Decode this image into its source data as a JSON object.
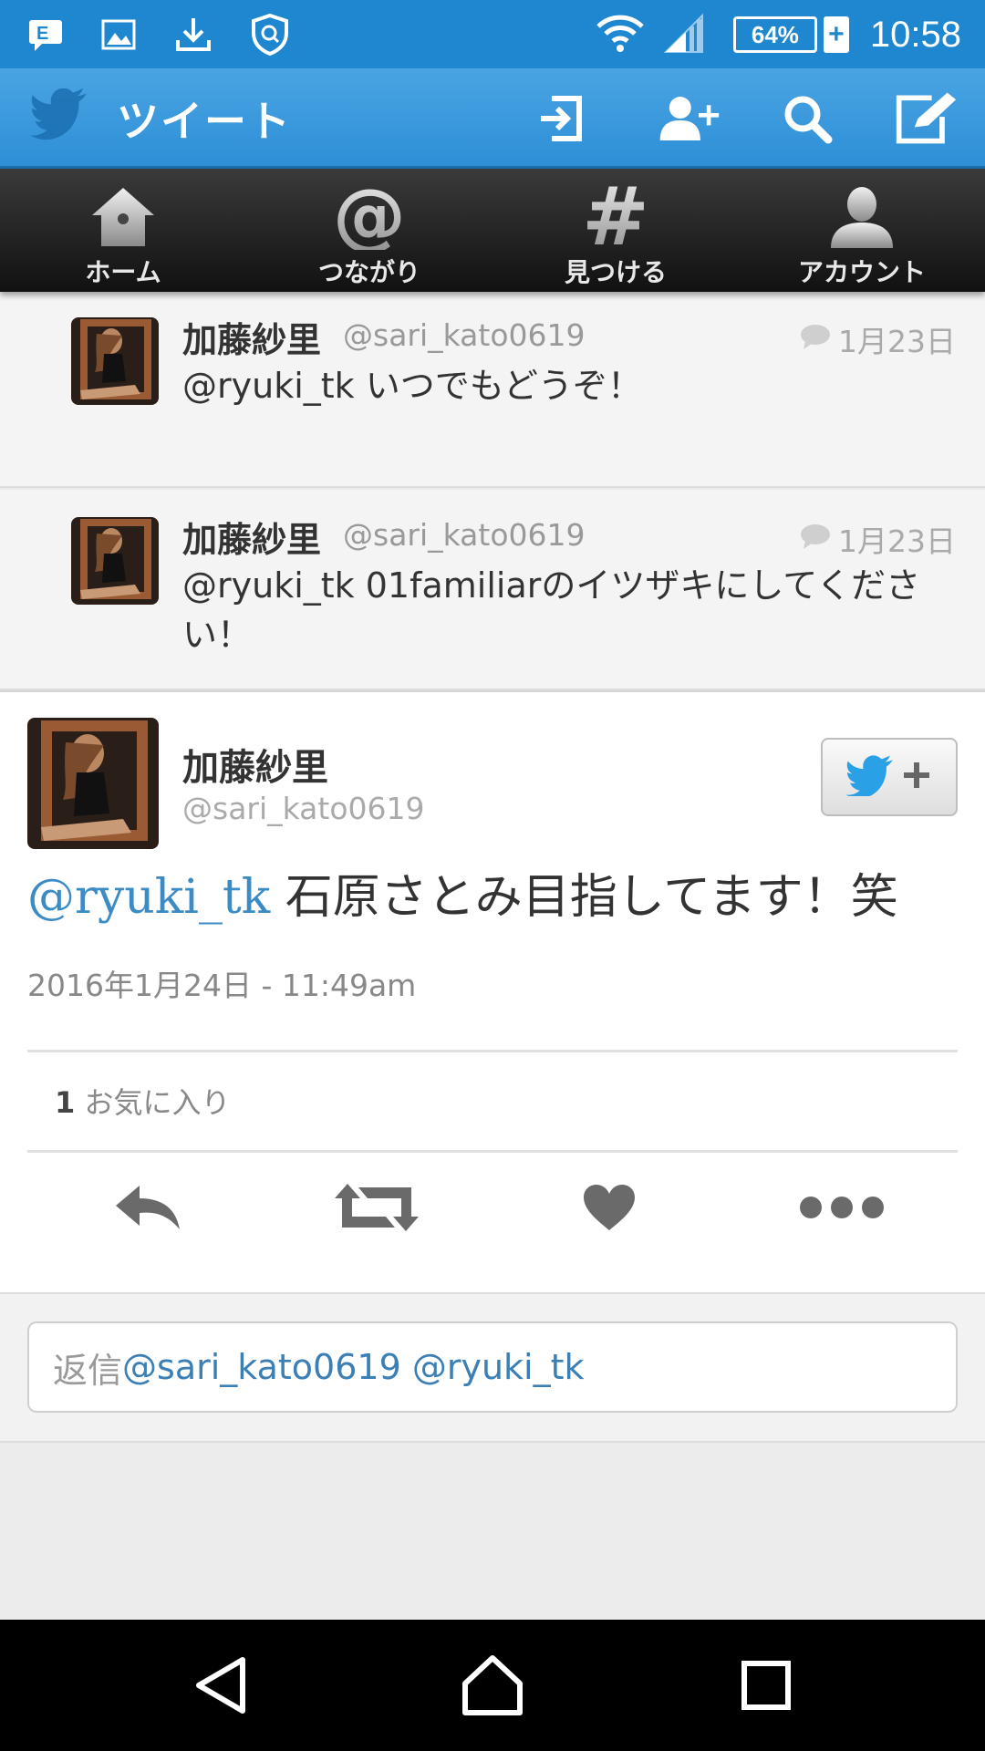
{
  "status_bar": {
    "time": "10:58",
    "battery_percent": "64%",
    "battery_charging": "+",
    "icons": [
      "message-notification-icon",
      "image-notification-icon",
      "download-icon",
      "shield-icon",
      "wifi-icon",
      "signal-icon"
    ]
  },
  "action_bar": {
    "title": "ツイート",
    "colors": {
      "bar": "#2e8fd6",
      "status": "#1f87cf"
    }
  },
  "tabs": [
    {
      "label": "ホーム",
      "icon": "home-icon"
    },
    {
      "label": "つながり",
      "icon": "at-icon"
    },
    {
      "label": "見つける",
      "icon": "hashtag-icon"
    },
    {
      "label": "アカウント",
      "icon": "account-icon"
    }
  ],
  "conversation": [
    {
      "name": "加藤紗里",
      "handle": "@sari_kato0619",
      "date": "1月23日",
      "text": "@ryuki_tk いつでもどうぞ！"
    },
    {
      "name": "加藤紗里",
      "handle": "@sari_kato0619",
      "date": "1月23日",
      "text": "@ryuki_tk 01familiarのイツザキにしてください！"
    }
  ],
  "main_tweet": {
    "name": "加藤紗里",
    "handle": "@sari_kato0619",
    "mention": "@ryuki_tk",
    "text": " 石原さとみ目指してます！笑",
    "timestamp": "2016年1月24日 - 11:49am",
    "favorite_count": "1",
    "favorite_label": " お気に入り",
    "mention_color": "#3b8cc4"
  },
  "reply": {
    "prefix": "返信",
    "handles": "@sari_kato0619 @ryuki_tk"
  }
}
